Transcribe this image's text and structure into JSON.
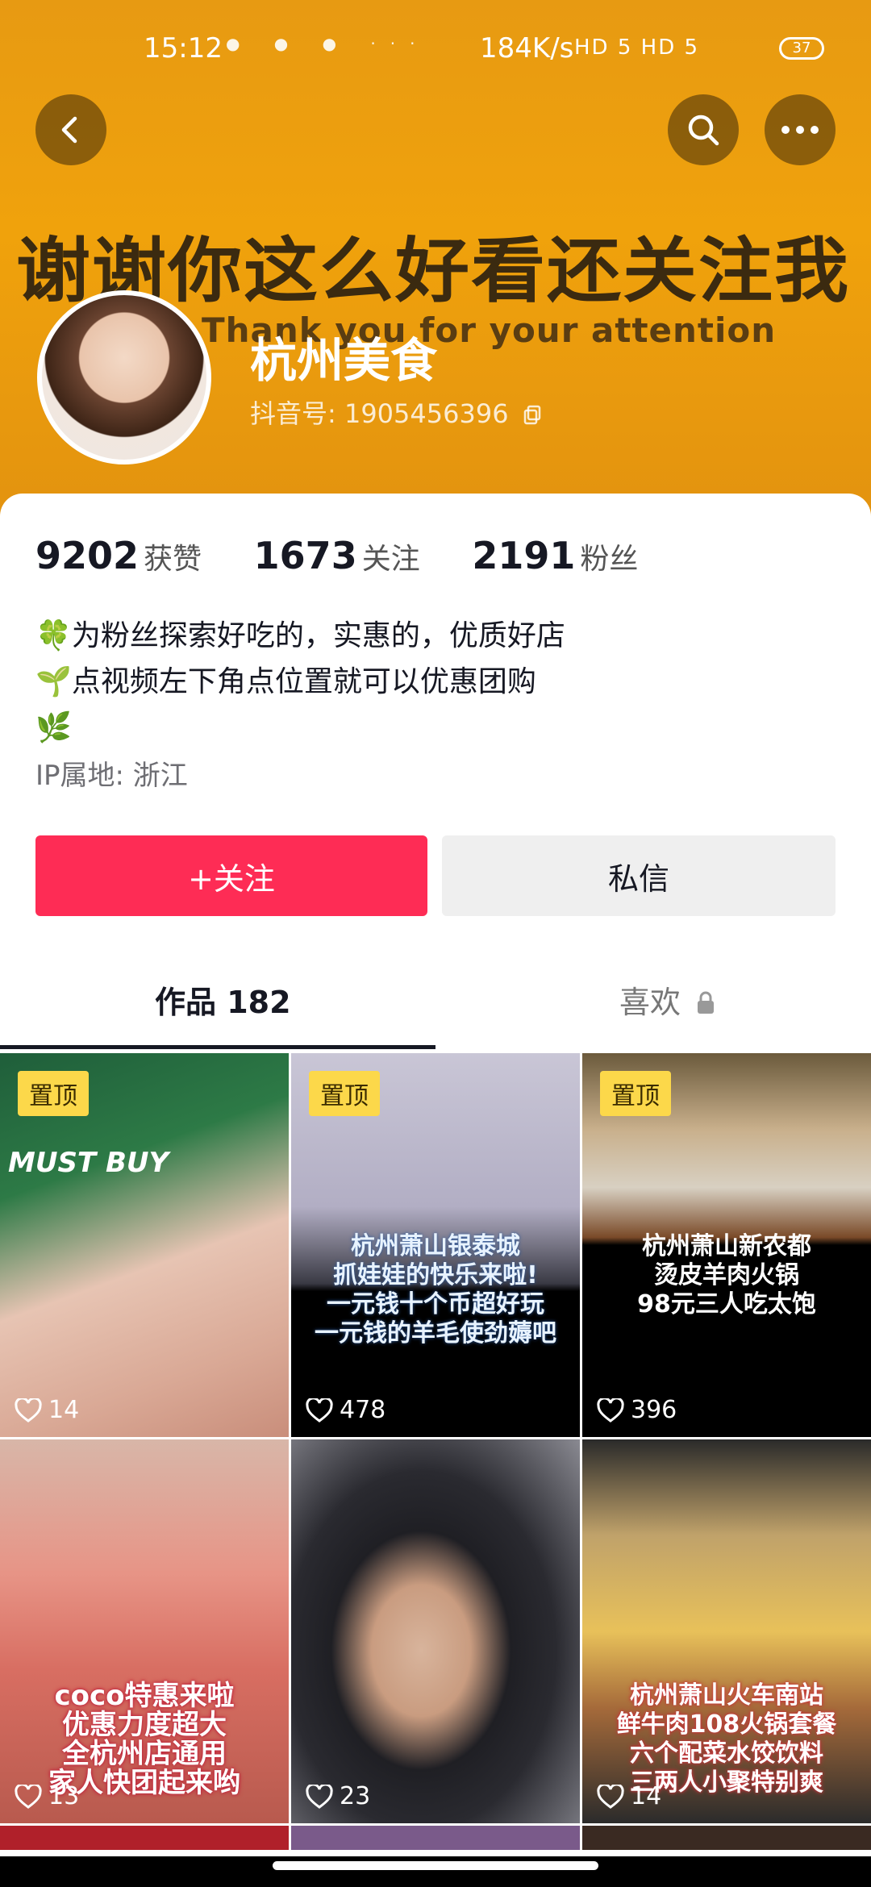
{
  "status": {
    "time": "15:12",
    "network_speed": "184K/s",
    "signal_text": "HD 5 HD 5",
    "battery": "37"
  },
  "banner": {
    "headline": "谢谢你这么好看还关注我",
    "subline": "Thank you for your attention"
  },
  "profile": {
    "name": "杭州美食",
    "douyin_id": "抖音号: 1905456396"
  },
  "stats": [
    {
      "value": "9202",
      "label": "获赞"
    },
    {
      "value": "1673",
      "label": "关注"
    },
    {
      "value": "2191",
      "label": "粉丝"
    }
  ],
  "bio": {
    "line1": "🍀为粉丝探索好吃的，实惠的，优质好店",
    "line2": "🌱点视频左下角点位置就可以优惠团购",
    "line3": "🌿",
    "ip": "IP属地: 浙江"
  },
  "actions": {
    "follow": "+关注",
    "message": "私信"
  },
  "tabs": {
    "works": "作品 182",
    "likes": "喜欢"
  },
  "videos": [
    {
      "pinned": "置顶",
      "caption": "MUST BUY",
      "likes": "14"
    },
    {
      "pinned": "置顶",
      "caption": "杭州萧山银泰城\n抓娃娃的快乐来啦!\n一元钱十个币超好玩\n一元钱的羊毛使劲薅吧",
      "likes": "478"
    },
    {
      "pinned": "置顶",
      "caption": "杭州萧山新农都\n烫皮羊肉火锅\n98元三人吃太饱",
      "likes": "396"
    },
    {
      "pinned": "",
      "caption": "coco特惠来啦\n优惠力度超大\n全杭州店通用\n家人快团起来哟",
      "likes": "13"
    },
    {
      "pinned": "",
      "caption": "",
      "likes": "23"
    },
    {
      "pinned": "",
      "caption": "杭州萧山火车南站\n鲜牛肉108火锅套餐\n六个配菜水饺饮料\n三两人小聚特别爽",
      "likes": "14"
    }
  ]
}
